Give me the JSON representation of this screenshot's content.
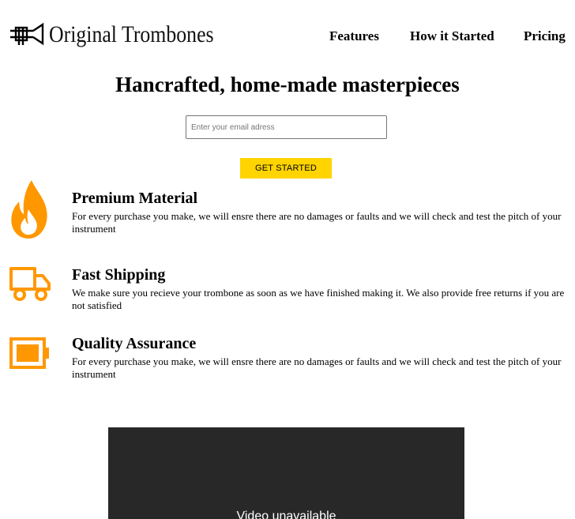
{
  "brand": {
    "name": "Original Trombones",
    "logo_icon": "trombone-icon"
  },
  "nav": {
    "items": [
      {
        "label": "Features"
      },
      {
        "label": "How it Started"
      },
      {
        "label": "Pricing"
      }
    ]
  },
  "hero": {
    "title": "Hancrafted, home-made masterpieces",
    "email_placeholder": "Enter your email adress",
    "email_value": "",
    "cta_label": "GET STARTED"
  },
  "features": [
    {
      "icon": "fire-icon",
      "title": "Premium Material",
      "text": "For every purchase you make, we will ensre there are no damages or faults and we will check and test the pitch of your instrument"
    },
    {
      "icon": "truck-icon",
      "title": "Fast Shipping",
      "text": "We make sure you recieve your trombone as soon as we have finished making it. We also provide free returns if you are not satisfied"
    },
    {
      "icon": "battery-icon",
      "title": "Quality Assurance",
      "text": "For every purchase you make, we will ensre there are no damages or faults and we will check and test the pitch of your instrument"
    }
  ],
  "video": {
    "message": "Video unavailable"
  },
  "colors": {
    "accent": "#ffd400",
    "icon": "#ff9800",
    "video_bg": "#282828"
  }
}
